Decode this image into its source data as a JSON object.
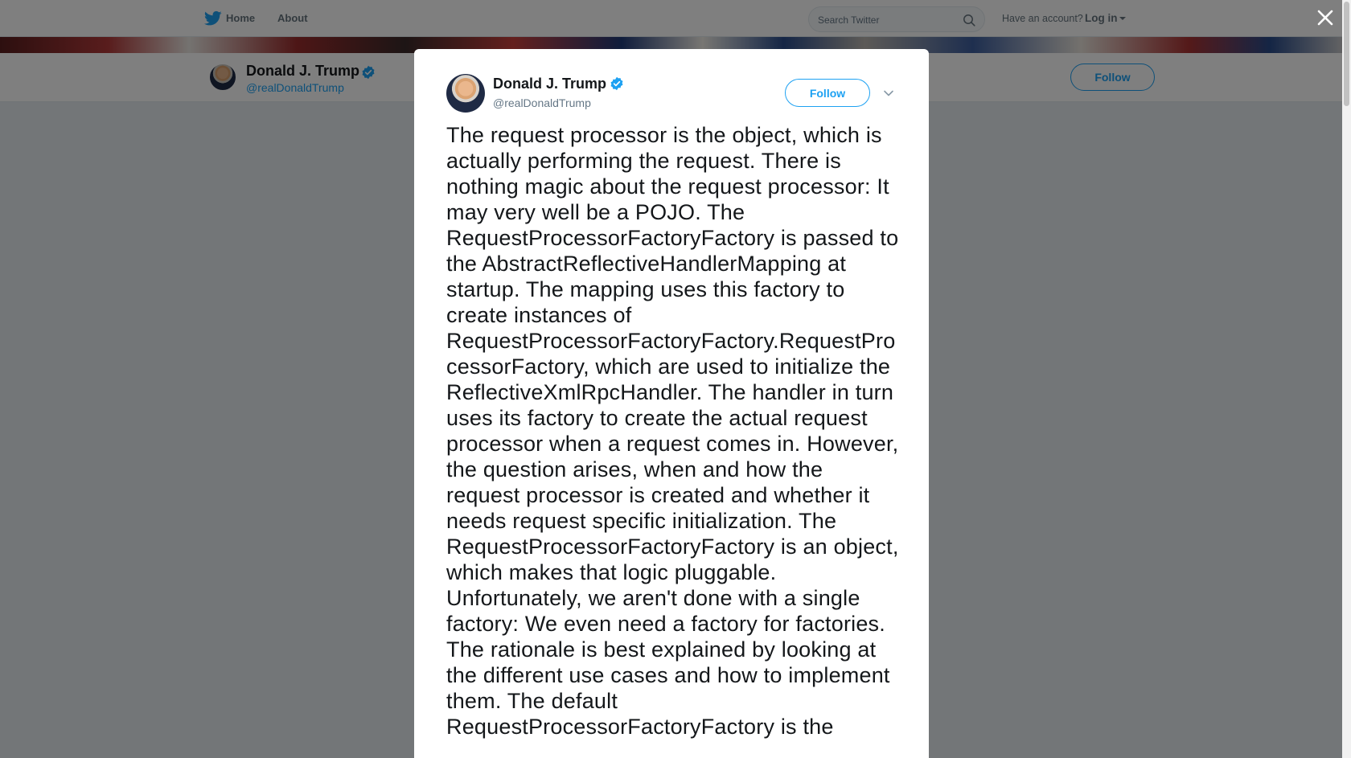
{
  "topnav": {
    "home_label": "Home",
    "about_label": "About",
    "search_placeholder": "Search Twitter",
    "have_account": "Have an account?",
    "login_label": "Log in"
  },
  "profile": {
    "name": "Donald J. Trump",
    "handle": "@realDonaldTrump",
    "follow_label": "Follow"
  },
  "modal": {
    "name": "Donald J. Trump",
    "handle": "@realDonaldTrump",
    "follow_label": "Follow",
    "tweet_text": "The request processor is the object, which is actually performing the request. There is nothing magic about the request processor: It may very well be a POJO. The RequestProcessorFactoryFactory is passed to the AbstractReflectiveHandlerMapping at startup. The mapping uses this factory to create instances of RequestProcessorFactoryFactory.RequestProcessorFactory, which are used to initialize the ReflectiveXmlRpcHandler. The handler in turn uses its factory to create the actual request processor when a request comes in. However, the question arises, when and how the request processor is created and whether it needs request specific initialization. The RequestProcessorFactoryFactory is an object, which makes that logic pluggable. Unfortunately, we aren't done with a single factory: We even need a factory for factories. The rationale is best explained by looking at the different use cases and how to implement them. The default RequestProcessorFactoryFactory is the"
  },
  "colors": {
    "accent": "#1da1f2",
    "overlay": "rgba(0,0,0,0.5)",
    "text": "#14171a",
    "muted": "#657786"
  },
  "icons": {
    "bird": "twitter-bird-icon",
    "search": "search-icon",
    "verified": "verified-badge-icon",
    "close": "close-icon",
    "caret": "chevron-down-icon"
  }
}
